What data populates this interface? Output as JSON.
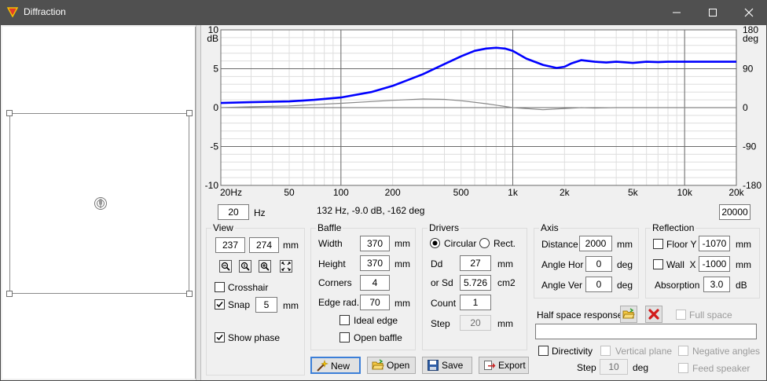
{
  "window": {
    "title": "Diffraction"
  },
  "chart_data": {
    "type": "line",
    "x_scale": "log",
    "xlim": [
      20,
      20000
    ],
    "x_ticks": [
      "20Hz",
      "50",
      "100",
      "200",
      "500",
      "1k",
      "2k",
      "5k",
      "10k",
      "20k"
    ],
    "ylim": [
      -10,
      10
    ],
    "ylabel_left": "dB",
    "y_ticks_left": [
      "10",
      "5",
      "0",
      "-5",
      "-10"
    ],
    "ylim_right": [
      -180,
      180
    ],
    "ylabel_right": "deg",
    "y_ticks_right": [
      "180",
      "90",
      "0",
      "-90",
      "-180"
    ],
    "grid": true,
    "series": [
      {
        "color": "#0000ff",
        "axis": "left",
        "x": [
          20,
          30,
          50,
          70,
          100,
          150,
          200,
          300,
          400,
          500,
          600,
          700,
          800,
          900,
          1000,
          1200,
          1500,
          1800,
          2000,
          2200,
          2500,
          3000,
          3500,
          4000,
          5000,
          6000,
          7000,
          8000,
          10000,
          15000,
          20000
        ],
        "y": [
          0.6,
          0.7,
          0.8,
          1.0,
          1.3,
          2.0,
          2.8,
          4.3,
          5.6,
          6.6,
          7.3,
          7.6,
          7.7,
          7.6,
          7.3,
          6.3,
          5.5,
          5.1,
          5.25,
          5.7,
          6.1,
          5.9,
          5.8,
          5.9,
          5.75,
          5.9,
          5.85,
          5.9,
          5.9,
          5.9,
          5.9
        ]
      },
      {
        "color": "#888888",
        "axis": "right",
        "x": [
          20,
          30,
          50,
          70,
          100,
          150,
          200,
          300,
          400,
          500,
          700,
          1000,
          1500,
          2000,
          2500,
          3000,
          4000,
          5000,
          7000,
          10000,
          20000
        ],
        "y": [
          0,
          2,
          4,
          7,
          10,
          14,
          17,
          20,
          19,
          16,
          9,
          0,
          -5,
          -2,
          0,
          -1,
          0,
          0,
          0,
          0,
          0
        ]
      }
    ]
  },
  "status_text": "132 Hz, -9.0 dB, -162 deg",
  "freq_min": "20",
  "freq_min_unit": "Hz",
  "freq_max": "20000",
  "view": {
    "title": "View",
    "w": "237",
    "h": "274",
    "unit": "mm",
    "crosshair_label": "Crosshair",
    "crosshair_checked": false,
    "snap_label": "Snap",
    "snap_checked": true,
    "snap_value": "5",
    "snap_unit": "mm",
    "show_phase_label": "Show phase",
    "show_phase_checked": true
  },
  "baffle": {
    "title": "Baffle",
    "width_label": "Width",
    "width": "370",
    "width_unit": "mm",
    "height_label": "Height",
    "height": "370",
    "height_unit": "mm",
    "corners_label": "Corners",
    "corners": "4",
    "edge_label": "Edge rad.",
    "edge": "70",
    "edge_unit": "mm",
    "ideal_edge_label": "Ideal edge",
    "open_baffle_label": "Open baffle"
  },
  "drivers": {
    "title": "Drivers",
    "circular_label": "Circular",
    "rect_label": "Rect.",
    "dd_label": "Dd",
    "dd": "27",
    "dd_unit": "mm",
    "sd_label": "or Sd",
    "sd": "5.726",
    "sd_unit": "cm2",
    "count_label": "Count",
    "count": "1",
    "step_label": "Step",
    "step": "20",
    "step_unit": "mm"
  },
  "axis": {
    "title": "Axis",
    "distance_label": "Distance",
    "distance": "2000",
    "distance_unit": "mm",
    "hor_label": "Angle Hor",
    "hor": "0",
    "hor_unit": "deg",
    "ver_label": "Angle Ver",
    "ver": "0",
    "ver_unit": "deg"
  },
  "reflection": {
    "title": "Reflection",
    "floor_label": "Floor Y",
    "floor": "-1070",
    "floor_unit": "mm",
    "wall_label": "Wall  X",
    "wall": "-1000",
    "wall_unit": "mm",
    "absorption_label": "Absorption",
    "absorption": "3.0",
    "absorption_unit": "dB"
  },
  "half_space": {
    "label": "Half space response",
    "full_space_label": "Full space",
    "path": "",
    "directivity_label": "Directivity",
    "vertical_plane_label": "Vertical plane",
    "negative_angles_label": "Negative angles",
    "step_label": "Step",
    "step": "10",
    "step_unit": "deg",
    "feed_speaker_label": "Feed speaker"
  },
  "buttons": {
    "new": "New",
    "open": "Open",
    "save": "Save",
    "export": "Export"
  }
}
